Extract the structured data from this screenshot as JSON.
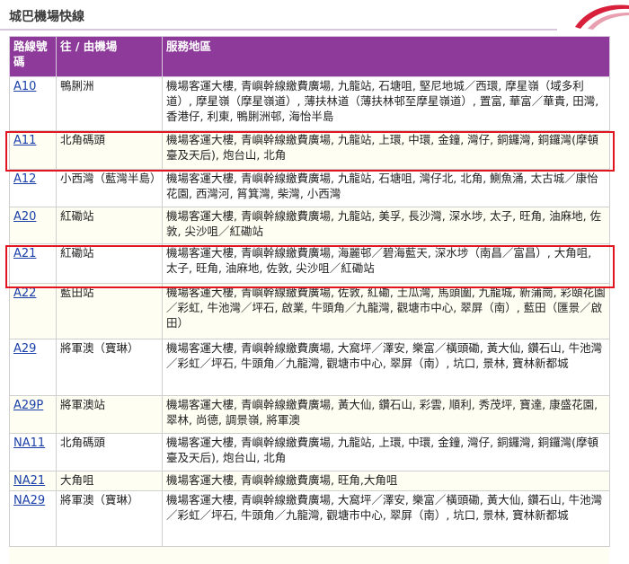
{
  "page_title": "城巴機場快線",
  "columns": {
    "route": "路線號碼",
    "terminus": "往 / 由機場",
    "area": "服務地區"
  },
  "rows": [
    {
      "route": "A10",
      "terminus": "鴨脷洲",
      "area": "機場客運大樓, 青嶼幹線繳費廣場, 九龍站, 石塘咀, 堅尼地城／西環, 摩星嶺（域多利道）, 摩星嶺（摩星嶺道）, 薄扶林道（薄扶林邨至摩星嶺道）, 置富, 華富／華貴, 田灣, 香港仔, 利東, 鴨脷洲邨, 海怡半島",
      "highlighted": false
    },
    {
      "route": "A11",
      "terminus": "北角碼頭",
      "area": "機場客運大樓, 青嶼幹線繳費廣場, 九龍站, 上環, 中環, 金鐘, 灣仔, 銅鑼灣, 銅鑼灣(摩頓臺及天后), 炮台山, 北角",
      "highlighted": true
    },
    {
      "route": "A12",
      "terminus": "小西灣（藍灣半島）",
      "area": "機場客運大樓, 青嶼幹線繳費廣場, 九龍站, 石塘咀, 灣仔北, 北角, 鰂魚涌, 太古城／康怡花園, 西灣河, 筲箕灣, 柴灣, 小西灣",
      "highlighted": false
    },
    {
      "route": "A20",
      "terminus": "紅磡站",
      "area": "機場客運大樓, 青嶼幹線繳費廣場, 九龍站, 美孚, 長沙灣, 深水埗, 太子, 旺角, 油麻地, 佐敦, 尖沙咀／紅磡站",
      "highlighted": false
    },
    {
      "route": "A21",
      "terminus": "紅磡站",
      "area": "機場客運大樓, 青嶼幹線繳費廣場, 海麗邨／碧海藍天, 深水埗（南昌／富昌）, 大角咀, 太子, 旺角, 油麻地, 佐敦, 尖沙咀／紅磡站",
      "highlighted": true
    },
    {
      "route": "A22",
      "terminus": "藍田站",
      "area": "機場客運大樓, 青嶼幹線繳費廣場, 佐敦, 紅磡, 土瓜灣, 馬頭圍, 九龍城, 新蒲崗, 彩頤花園／彩虹, 牛池灣／坪石, 啟業, 牛頭角／九龍灣, 觀塘市中心, 翠屏（南）, 藍田（匯景／啟田）",
      "highlighted": false
    },
    {
      "route": "A29",
      "terminus": "將軍澳（寶琳）",
      "area": "機場客運大樓, 青嶼幹線繳費廣場, 大窩坪／澤安, 樂富／橫頭磡, 黃大仙, 鑽石山, 牛池灣／彩虹／坪石, 牛頭角／九龍灣, 觀塘市中心, 翠屏（南）, 坑口, 景林, 寶林新都城",
      "highlighted": false
    },
    {
      "route": "A29P",
      "terminus": "將軍澳站",
      "area": "機場客運大樓, 青嶼幹線繳費廣場, 黃大仙, 鑽石山, 彩雲, 順利, 秀茂坪, 寶達, 康盛花園, 翠林, 尚德, 調景嶺, 將軍澳",
      "highlighted": false
    },
    {
      "route": "NA11",
      "terminus": "北角碼頭",
      "area": "機場客運大樓, 青嶼幹線繳費廣場, 九龍站, 上環, 中環, 金鐘, 灣仔, 銅鑼灣, 銅鑼灣(摩頓臺及天后), 炮台山, 北角",
      "highlighted": false
    },
    {
      "route": "NA21",
      "terminus": "大角咀",
      "area": "機場客運大樓, 青嶼幹線繳費廣場, 旺角,大角咀",
      "highlighted": false
    },
    {
      "route": "NA29",
      "terminus": "將軍澳（寶琳）",
      "area": "機場客運大樓, 青嶼幹線繳費廣場, 大窩坪／澤安, 樂富／橫頭磡, 黃大仙, 鑽石山, 牛池灣／彩虹／坪石, 牛頭角／九龍灣, 觀塘市中心, 翠屏（南）, 坑口, 景林, 寶林新都城",
      "highlighted": false
    }
  ],
  "colors": {
    "header_bg": "#8d3a9a",
    "link": "#1a3fa8",
    "highlight_box": "#e0151f"
  }
}
